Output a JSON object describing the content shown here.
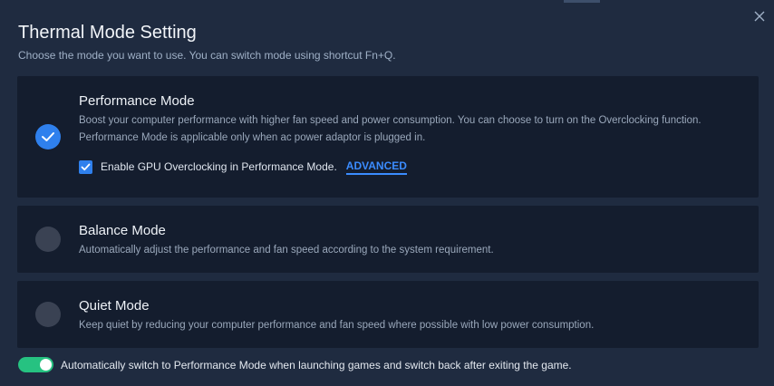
{
  "dialog": {
    "title": "Thermal Mode Setting",
    "subtitle": "Choose the mode you want to use. You can switch mode using shortcut Fn+Q.",
    "close_icon": "close-icon"
  },
  "modes": [
    {
      "title": "Performance Mode",
      "description": "Boost your computer performance with higher fan speed and power consumption. You can choose to turn on the Overclocking function. Performance Mode is applicable only when ac power adaptor is plugged in.",
      "selected": true
    },
    {
      "title": "Balance Mode",
      "description": "Automatically adjust the performance and fan speed according to the system requirement.",
      "selected": false
    },
    {
      "title": "Quiet Mode",
      "description": "Keep quiet by reducing your computer performance and fan speed where possible with low power consumption.",
      "selected": false
    }
  ],
  "gpu_overclock": {
    "label": "Enable GPU Overclocking in Performance Mode.",
    "checked": true,
    "advanced_label": "ADVANCED"
  },
  "auto_switch": {
    "label": "Automatically switch to Performance Mode when launching games and switch back after exiting the game.",
    "enabled": true
  },
  "colors": {
    "background": "#1f2b40",
    "card": "#141d2e",
    "accent_blue": "#2f80ed",
    "link_blue": "#3b8cff",
    "toggle_green": "#26c281"
  }
}
